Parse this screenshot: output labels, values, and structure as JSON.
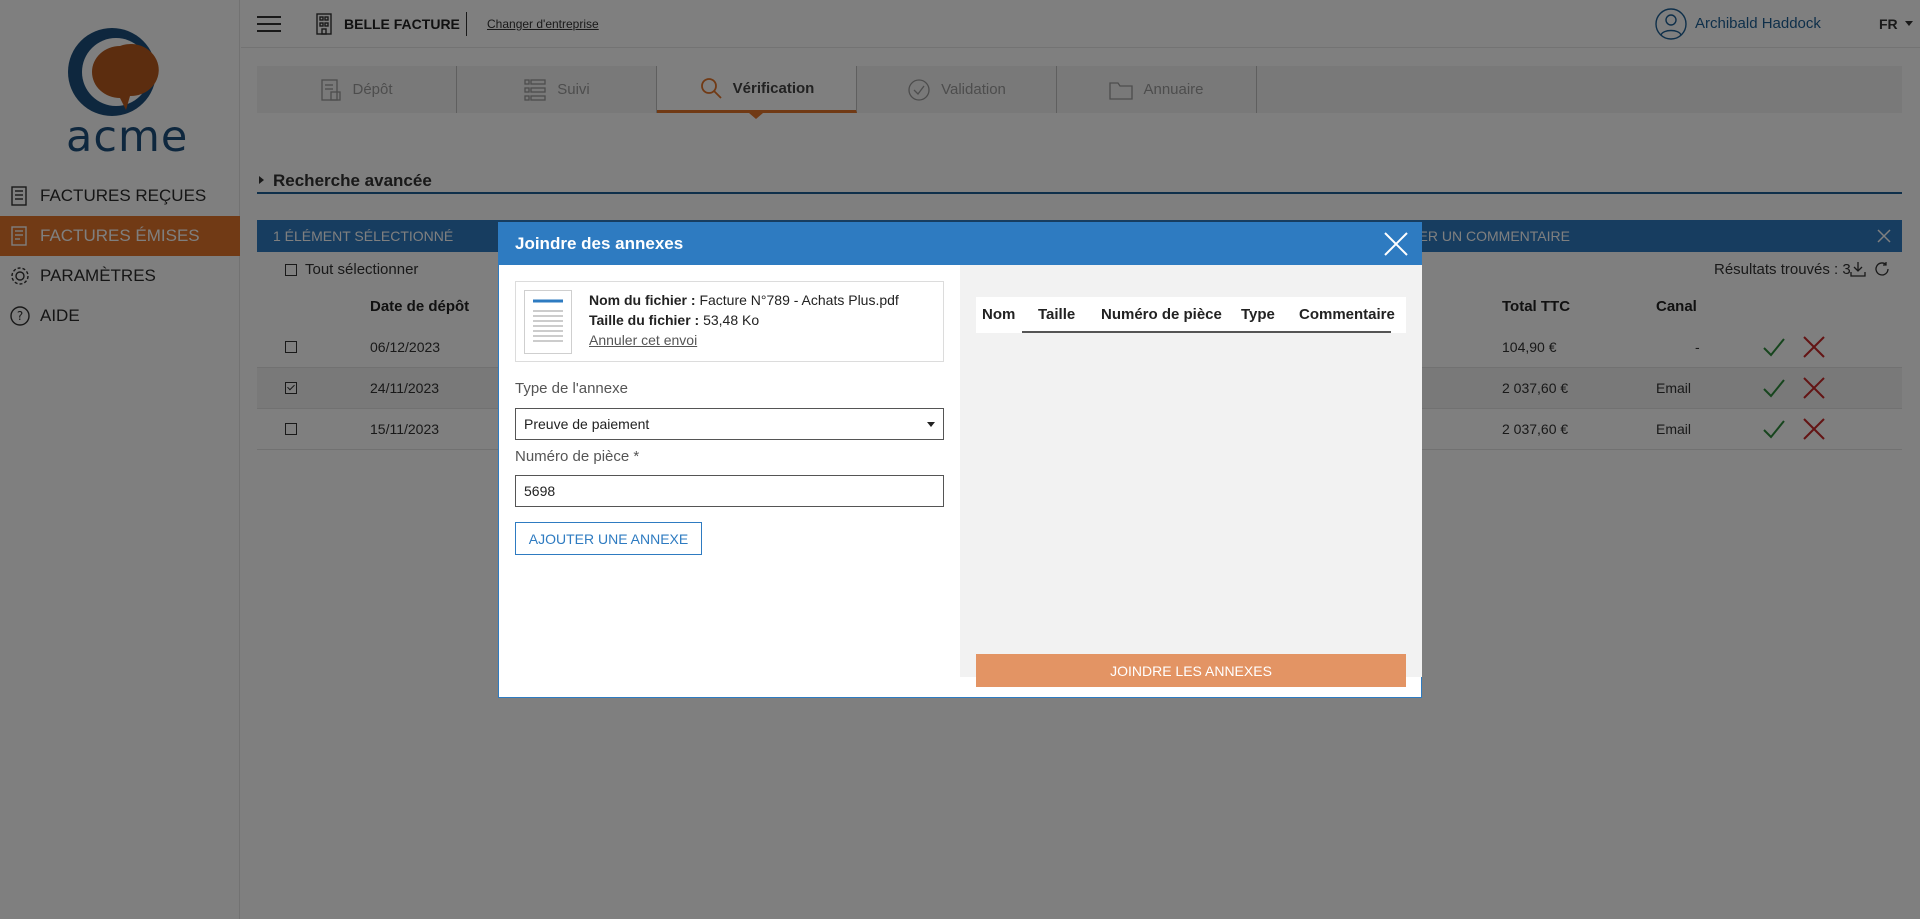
{
  "app": {
    "brand": "acme",
    "company_name": "BELLE FACTURE",
    "change_company": "Changer d'entreprise",
    "user_name": "Archibald Haddock",
    "language": "FR"
  },
  "sidebar": {
    "items": [
      {
        "label": "FACTURES REÇUES",
        "icon": "received-invoices-icon"
      },
      {
        "label": "FACTURES ÉMISES",
        "icon": "issued-invoices-icon",
        "active": true
      },
      {
        "label": "PARAMÈTRES",
        "icon": "gear-icon"
      },
      {
        "label": "AIDE",
        "icon": "help-icon"
      }
    ]
  },
  "tabs": [
    {
      "label": "Dépôt",
      "icon": "deposit-icon"
    },
    {
      "label": "Suivi",
      "icon": "list-icon"
    },
    {
      "label": "Vérification",
      "icon": "search-icon",
      "active": true
    },
    {
      "label": "Validation",
      "icon": "check-circle-icon"
    },
    {
      "label": "Annuaire",
      "icon": "folder-icon"
    }
  ],
  "advanced_search": "Recherche avancée",
  "selection_bar": {
    "left": "1 ÉLÉMENT SÉLECTIONNÉ",
    "right": "TER UN COMMENTAIRE"
  },
  "list": {
    "select_all": "Tout sélectionner",
    "results": "Résultats trouvés : 3",
    "headers": {
      "date": "Date de dépôt",
      "total": "Total TTC",
      "channel": "Canal"
    },
    "rows": [
      {
        "date": "06/12/2023",
        "total": "104,90 €",
        "channel": "-",
        "checked": false
      },
      {
        "date": "24/11/2023",
        "total": "2 037,60 €",
        "channel": "Email",
        "checked": true
      },
      {
        "date": "15/11/2023",
        "total": "2 037,60 €",
        "channel": "Email",
        "checked": false
      }
    ]
  },
  "modal": {
    "title": "Joindre des annexes",
    "file_name_label": "Nom du fichier :",
    "file_name": "Facture N°789 - Achats Plus.pdf",
    "file_size_label": "Taille du fichier :",
    "file_size": "53,48 Ko",
    "cancel_link": "Annuler cet envoi",
    "type_label": "Type de l'annexe",
    "type_value": "Preuve de paiement",
    "piece_label": "Numéro de pièce *",
    "piece_value": "5698",
    "add_button": "AJOUTER UNE ANNEXE",
    "annex_headers": [
      "Nom",
      "Taille",
      "Numéro de pièce",
      "Type",
      "Commentaire"
    ],
    "join_button": "JOINDRE LES ANNEXES"
  },
  "colors": {
    "accent": "#e2742a",
    "primary": "#2e7bc1",
    "join_button": "#e39464",
    "valid": "#2e8b3c",
    "reject": "#c62828"
  }
}
